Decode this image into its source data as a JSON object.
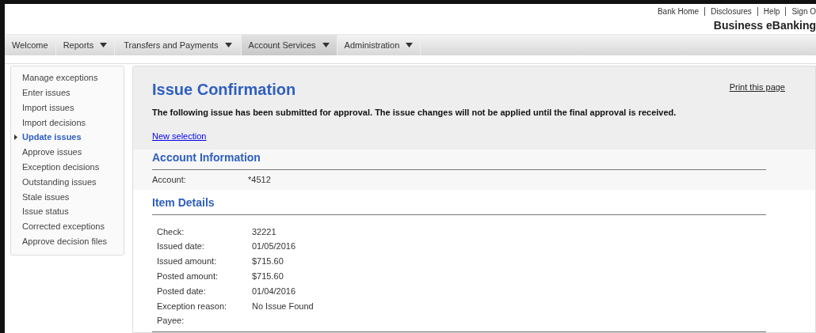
{
  "top_links": [
    "Bank Home",
    "Disclosures",
    "Help",
    "Sign O"
  ],
  "brand": "Business eBanking",
  "nav": [
    {
      "label": "Welcome",
      "dropdown": false,
      "selected": false
    },
    {
      "label": "Reports",
      "dropdown": true,
      "selected": false
    },
    {
      "label": "Transfers and Payments",
      "dropdown": true,
      "selected": false
    },
    {
      "label": "Account Services",
      "dropdown": true,
      "selected": true
    },
    {
      "label": "Administration",
      "dropdown": true,
      "selected": false
    }
  ],
  "sidebar": {
    "items": [
      {
        "label": "Manage exceptions",
        "selected": false
      },
      {
        "label": "Enter issues",
        "selected": false
      },
      {
        "label": "Import issues",
        "selected": false
      },
      {
        "label": "Import decisions",
        "selected": false
      },
      {
        "label": "Update issues",
        "selected": true
      },
      {
        "label": "Approve issues",
        "selected": false
      },
      {
        "label": "Exception decisions",
        "selected": false
      },
      {
        "label": "Outstanding issues",
        "selected": false
      },
      {
        "label": "Stale issues",
        "selected": false
      },
      {
        "label": "Issue status",
        "selected": false
      },
      {
        "label": "Corrected exceptions",
        "selected": false
      },
      {
        "label": "Approve decision files",
        "selected": false
      }
    ]
  },
  "main": {
    "title": "Issue Confirmation",
    "print_link": "Print this page",
    "message": "The following issue has been submitted for approval. The issue changes will not be applied until the final approval is received.",
    "new_selection_link": "New selection",
    "account_section": {
      "heading": "Account Information",
      "fields": [
        {
          "label": "Account:",
          "value": "*4512"
        }
      ]
    },
    "item_section": {
      "heading": "Item Details",
      "fields": [
        {
          "label": "Check:",
          "value": "32221"
        },
        {
          "label": "Issued date:",
          "value": "01/05/2016"
        },
        {
          "label": "Issued amount:",
          "value": "$715.60"
        },
        {
          "label": "Posted amount:",
          "value": "$715.60"
        },
        {
          "label": "Posted date:",
          "value": "01/04/2016"
        },
        {
          "label": "Exception reason:",
          "value": "No Issue Found"
        },
        {
          "label": "Payee:"
        }
      ]
    }
  }
}
